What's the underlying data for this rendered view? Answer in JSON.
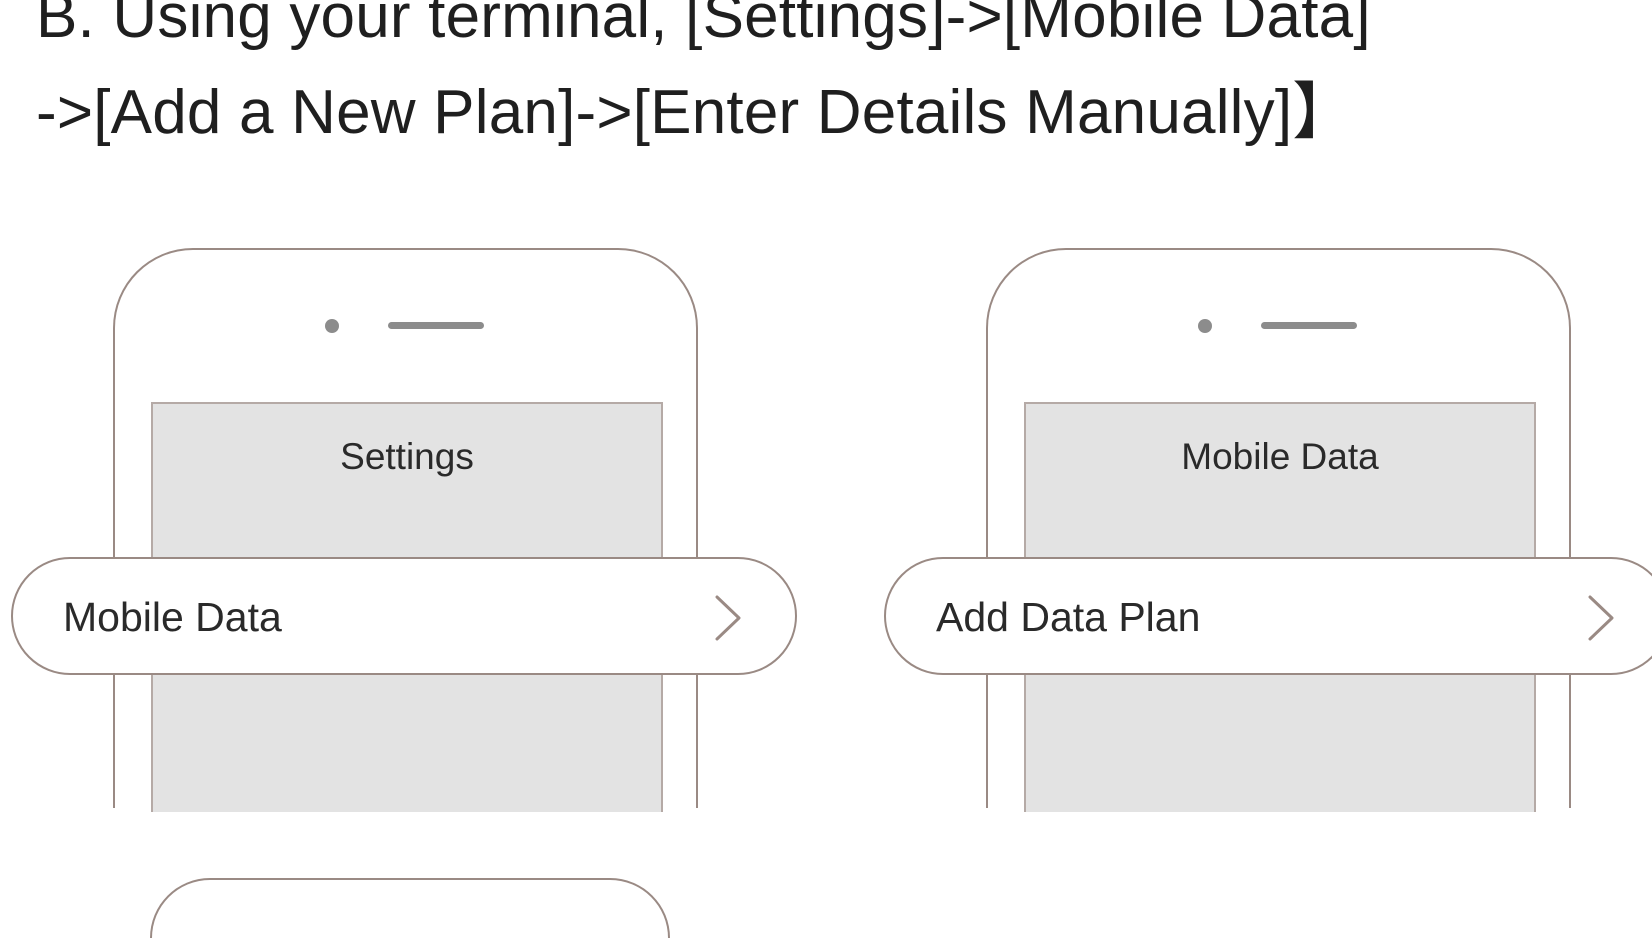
{
  "instruction": {
    "line1": "B. Using your terminal, [Settings]->[Mobile Data]",
    "line2": "->[Add a New Plan]->[Enter Details Manually]】"
  },
  "phones": [
    {
      "screen_title": "Settings",
      "row_label": "Mobile Data",
      "row_icon": "chevron-right-icon"
    },
    {
      "screen_title": "Mobile Data",
      "row_label": "Add Data Plan",
      "row_icon": "chevron-right-icon"
    }
  ],
  "colors": {
    "outline": "#9a8a84",
    "screen": "#e3e3e3",
    "text": "#1f1f1f"
  }
}
